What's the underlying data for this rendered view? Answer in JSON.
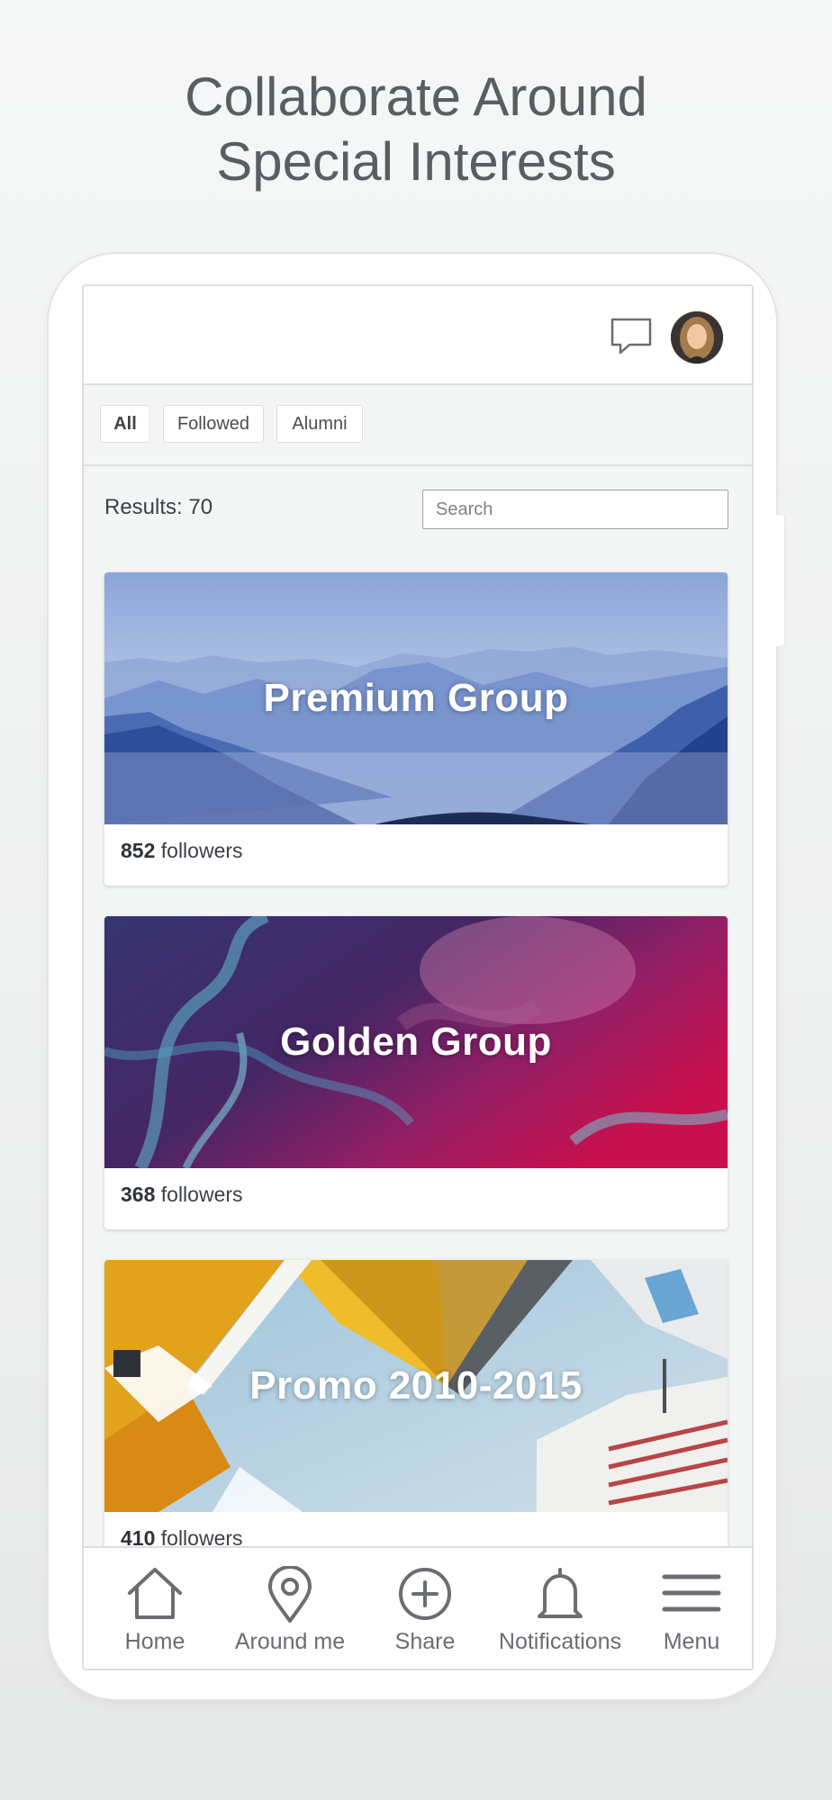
{
  "headline": {
    "line1": "Collaborate Around",
    "line2": "Special Interests"
  },
  "header": {
    "chat_icon": "chat-bubble-icon",
    "avatar": "user-avatar"
  },
  "filters": {
    "all": "All",
    "followed": "Followed",
    "alumni": "Alumni",
    "active": "All"
  },
  "results": {
    "label": "Results: 70"
  },
  "search": {
    "placeholder": "Search"
  },
  "groups": [
    {
      "name": "Premium Group",
      "followers": "852",
      "followers_suffix": " followers",
      "theme": "blue-mountains"
    },
    {
      "name": "Golden Group",
      "followers": "368",
      "followers_suffix": " followers",
      "theme": "magenta-smoke"
    },
    {
      "name": "Promo 2010-2015",
      "followers": "410",
      "followers_suffix": " followers",
      "theme": "cube-houses"
    }
  ],
  "nav": {
    "home": "Home",
    "around": "Around me",
    "share": "Share",
    "notifications": "Notifications",
    "menu": "Menu"
  },
  "colors": {
    "text_gray": "#5a5d61",
    "nav_gray": "#6a6d71",
    "border": "#dcdedf"
  }
}
